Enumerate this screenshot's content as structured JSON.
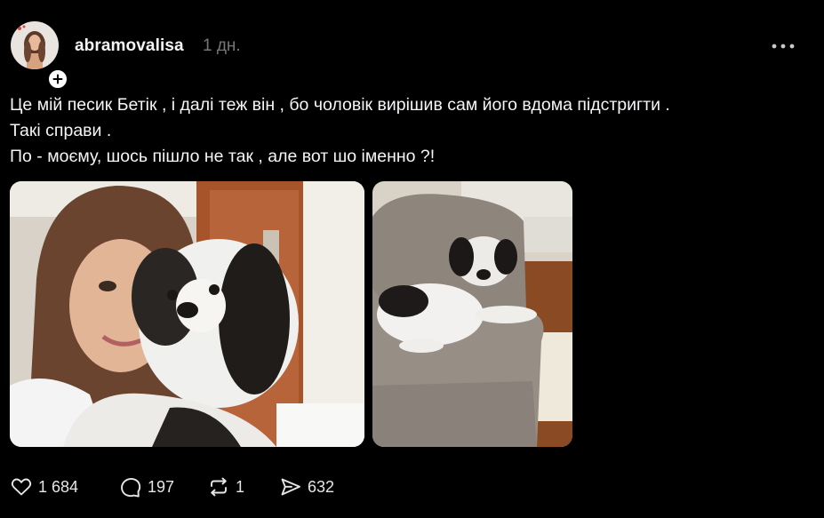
{
  "post": {
    "author": "abramovalisa",
    "time": "1 дн.",
    "text_lines": [
      "Це мій песик Бетік , і далі теж він , бо чоловік вирішив сам його вдома підстригти .",
      "Такі справи .",
      "По - моєму, шось пішло не так , але вот шо іменно ?!"
    ],
    "media": [
      {
        "kind": "photo",
        "subject": "woman holding dog"
      },
      {
        "kind": "photo",
        "subject": "dog on armchair"
      }
    ]
  },
  "actions": {
    "likes": "1 684",
    "replies": "197",
    "reposts": "1",
    "shares": "632"
  },
  "icons": {
    "follow": "plus-icon",
    "more": "more-dots-icon",
    "like": "heart-icon",
    "reply": "comment-icon",
    "repost": "repost-icon",
    "share": "send-icon"
  },
  "colors": {
    "background": "#000000",
    "text": "#f3f5f7",
    "muted": "#777777"
  }
}
